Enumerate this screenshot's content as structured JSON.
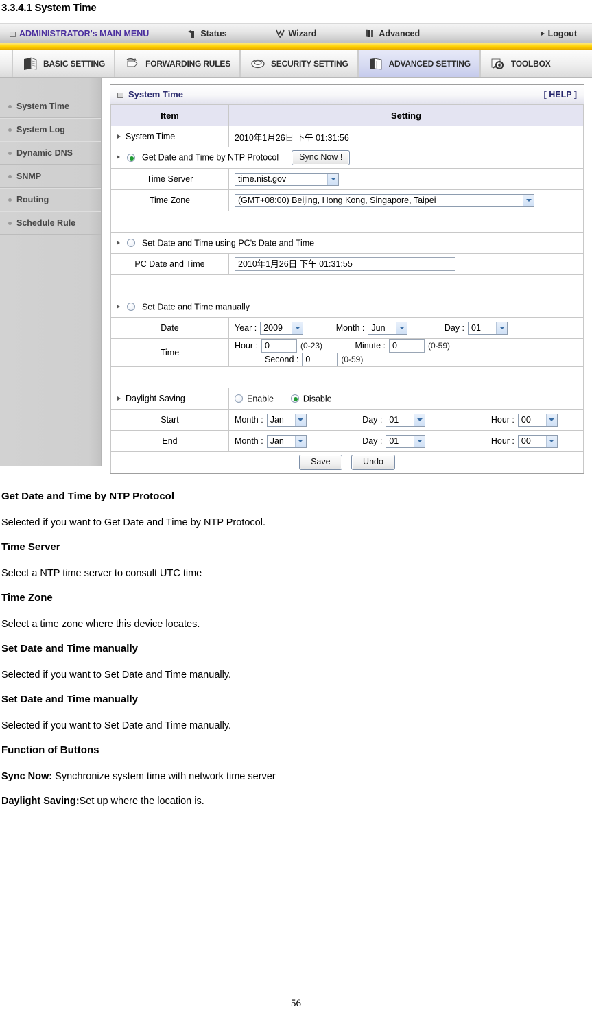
{
  "doc": {
    "heading": "3.3.4.1 System Time",
    "page_number": "56"
  },
  "top_menu": {
    "admin_label": "ADMINISTRATOR's MAIN MENU",
    "items": [
      {
        "label": "Status",
        "icon": "status-icon"
      },
      {
        "label": "Wizard",
        "icon": "wizard-icon"
      },
      {
        "label": "Advanced",
        "icon": "advanced-icon"
      }
    ],
    "logout_label": "Logout"
  },
  "tab_bar": {
    "tabs": [
      {
        "label": "BASIC SETTING",
        "icon": "book-icon",
        "active": false
      },
      {
        "label": "FORWARDING RULES",
        "icon": "arrow-pages-icon",
        "active": false
      },
      {
        "label": "SECURITY SETTING",
        "icon": "shield-icon",
        "active": false
      },
      {
        "label": "ADVANCED SETTING",
        "icon": "open-book-icon",
        "active": true
      },
      {
        "label": "TOOLBOX",
        "icon": "tools-icon",
        "active": false
      }
    ],
    "active_bg": "#d0d5ef"
  },
  "sidebar": {
    "items": [
      {
        "label": "System Time"
      },
      {
        "label": "System Log"
      },
      {
        "label": "Dynamic DNS"
      },
      {
        "label": "SNMP"
      },
      {
        "label": "Routing"
      },
      {
        "label": "Schedule Rule"
      }
    ]
  },
  "panel": {
    "title": "System Time",
    "help_label": "[ HELP ]",
    "columns": {
      "item": "Item",
      "setting": "Setting"
    },
    "system_time": {
      "label": "System Time",
      "value": "2010年1月26日 下午 01:31:56"
    },
    "ntp": {
      "label": "Get Date and Time by NTP Protocol",
      "selected": true,
      "sync_button": "Sync Now !",
      "time_server": {
        "label": "Time Server",
        "value": "time.nist.gov"
      },
      "time_zone": {
        "label": "Time Zone",
        "value": "(GMT+08:00) Beijing, Hong Kong, Singapore, Taipei"
      }
    },
    "pc_time": {
      "label": "Set Date and Time using PC's Date and Time",
      "selected": false,
      "field_label": "PC Date and Time",
      "value": "2010年1月26日 下午 01:31:55"
    },
    "manual": {
      "label": "Set Date and Time manually",
      "selected": false,
      "date": {
        "row_label": "Date",
        "year_label": "Year :",
        "year_value": "2009",
        "month_label": "Month :",
        "month_value": "Jun",
        "day_label": "Day :",
        "day_value": "01"
      },
      "time": {
        "row_label": "Time",
        "hour_label": "Hour :",
        "hour_value": "0",
        "hour_hint": "(0-23)",
        "minute_label": "Minute :",
        "minute_value": "0",
        "minute_hint": "(0-59)",
        "second_label": "Second :",
        "second_value": "0",
        "second_hint": "(0-59)"
      }
    },
    "daylight_saving": {
      "label": "Daylight Saving",
      "enable_label": "Enable",
      "disable_label": "Disable",
      "selected": "Disable",
      "start": {
        "row_label": "Start",
        "month_label": "Month :",
        "month_value": "Jan",
        "day_label": "Day :",
        "day_value": "01",
        "hour_label": "Hour :",
        "hour_value": "00"
      },
      "end": {
        "row_label": "End",
        "month_label": "Month :",
        "month_value": "Jan",
        "day_label": "Day :",
        "day_value": "01",
        "hour_label": "Hour :",
        "hour_value": "00"
      }
    },
    "buttons": {
      "save": "Save",
      "undo": "Undo"
    }
  },
  "prose": {
    "h1": "Get Date and Time by NTP Protocol",
    "p1": "Selected if you want to Get Date and Time by NTP Protocol.",
    "h2": "Time Server",
    "p2": "Select a NTP time server to consult UTC time",
    "h3": "Time Zone",
    "p3": "Select a time zone where this device locates.",
    "h4": "Set Date and Time manually",
    "p4": "Selected if you want to Set Date and Time manually.",
    "h5": "Set Date and Time manually",
    "p5": "Selected if you want to Set Date and Time manually.",
    "h6": "Function of Buttons",
    "p6_bold": "Sync Now:",
    "p6_rest": " Synchronize system time with network time server",
    "p7_bold": "Daylight Saving:",
    "p7_rest": "Set up where the location is."
  }
}
